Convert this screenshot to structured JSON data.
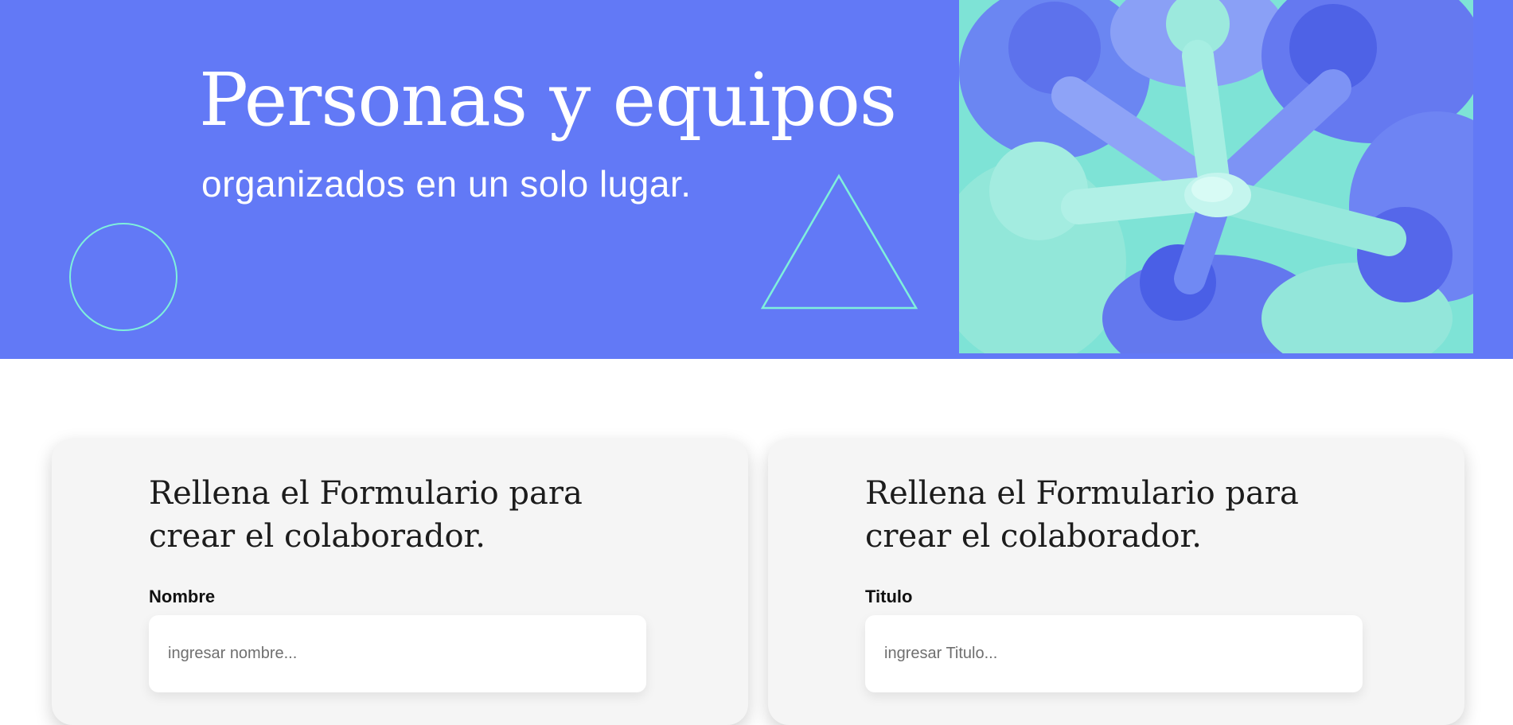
{
  "hero": {
    "title": "Personas y equipos",
    "subtitle": "organizados en un solo lugar.",
    "background_color": "#6279f6",
    "accent_color": "#7ff0dc",
    "image": "team-hands-together-photo"
  },
  "forms": [
    {
      "heading": "Rellena el Formulario para crear el colaborador.",
      "field_label": "Nombre",
      "field_placeholder": "ingresar nombre...",
      "field_value": ""
    },
    {
      "heading": "Rellena el Formulario para crear el colaborador.",
      "field_label": "Titulo",
      "field_placeholder": "ingresar Titulo...",
      "field_value": ""
    }
  ]
}
